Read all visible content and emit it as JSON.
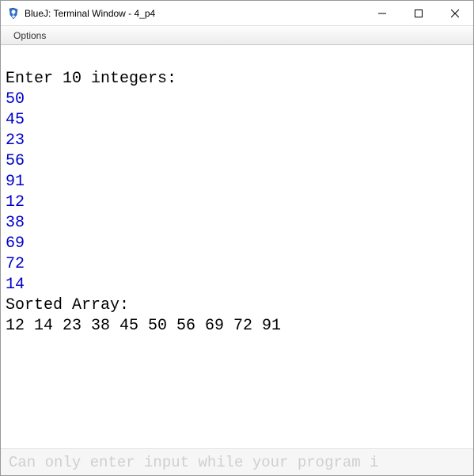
{
  "window": {
    "title": "BlueJ: Terminal Window - 4_p4"
  },
  "menu": {
    "options": "Options"
  },
  "terminal": {
    "prompt": "Enter 10 integers:",
    "inputs": [
      "50",
      "45",
      "23",
      "56",
      "91",
      "12",
      "38",
      "69",
      "72",
      "14"
    ],
    "sorted_label": "Sorted Array:",
    "sorted_values": "12 14 23 38 45 50 56 69 72 91"
  },
  "inputbar": {
    "placeholder": "Can only enter input while your program i"
  }
}
